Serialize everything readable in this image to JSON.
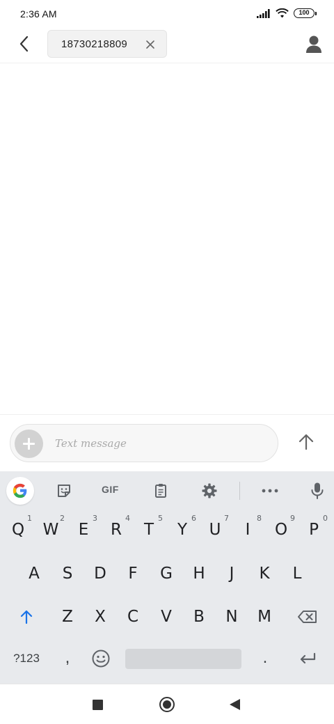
{
  "status_bar": {
    "time": "2:36 AM",
    "battery": "100",
    "icons": [
      "signal-icon",
      "wifi-icon",
      "battery-icon"
    ]
  },
  "header": {
    "back_icon": "chevron-left-icon",
    "recipient": "18730218809",
    "chip_close_icon": "close-icon",
    "contact_icon": "person-icon"
  },
  "composer": {
    "attach_icon": "plus-icon",
    "placeholder": "Text message",
    "send_icon": "arrow-up-icon"
  },
  "keyboard": {
    "toolbar": [
      "google-icon",
      "sticker-icon",
      "GIF",
      "clipboard-icon",
      "gear-icon",
      "more-icon",
      "mic-icon"
    ],
    "gif_label": "GIF",
    "rows": {
      "row1": [
        "Q",
        "W",
        "E",
        "R",
        "T",
        "Y",
        "U",
        "I",
        "O",
        "P"
      ],
      "row1_hints": [
        "1",
        "2",
        "3",
        "4",
        "5",
        "6",
        "7",
        "8",
        "9",
        "0"
      ],
      "row2": [
        "A",
        "S",
        "D",
        "F",
        "G",
        "H",
        "J",
        "K",
        "L"
      ],
      "row3": [
        "Z",
        "X",
        "C",
        "V",
        "B",
        "N",
        "M"
      ]
    },
    "symbols_label": "?123",
    "comma_label": ",",
    "period_label": ".",
    "accent_color": "#1a73e8"
  },
  "nav_bar": {
    "icons": [
      "recents-icon",
      "home-icon",
      "back-triangle-icon"
    ]
  }
}
